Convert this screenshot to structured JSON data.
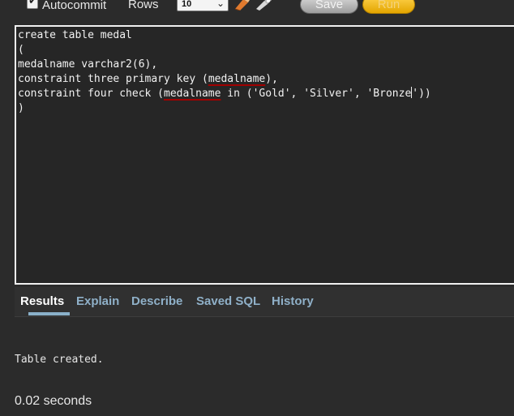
{
  "toolbar": {
    "autocommit_label": "Autocommit",
    "autocommit_checked": true,
    "rows_label": "Rows",
    "rows_value": "10",
    "save_label": "Save",
    "run_label": "Run",
    "icons": [
      "eraser-icon",
      "flashlight-icon"
    ]
  },
  "editor": {
    "lines": [
      "create table medal",
      "(",
      "medalname varchar2(6),",
      "constraint three primary key (medalname),",
      "constraint four check (medalname in ('Gold', 'Silver', 'Bronze'))",
      ")"
    ]
  },
  "tabs": [
    {
      "label": "Results",
      "active": true
    },
    {
      "label": "Explain",
      "active": false
    },
    {
      "label": "Describe",
      "active": false
    },
    {
      "label": "Saved SQL",
      "active": false
    },
    {
      "label": "History",
      "active": false
    }
  ],
  "results": {
    "message": "Table created.",
    "timing": "0.02 seconds"
  },
  "colors": {
    "background": "#2b2b2b",
    "tab_link": "#8fb0c8",
    "run_button": "#f2b500",
    "error_underline": "#a00000"
  }
}
